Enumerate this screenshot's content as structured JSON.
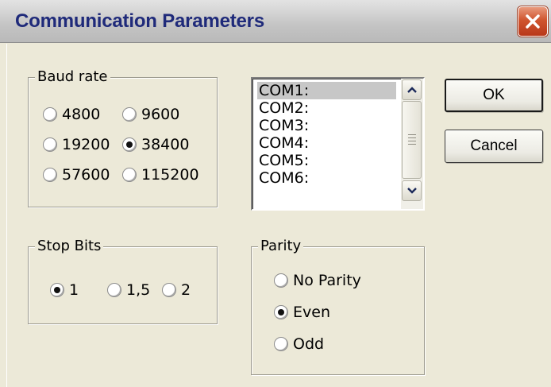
{
  "window": {
    "title": "Communication Parameters",
    "close_icon": "close-icon"
  },
  "baud_rate": {
    "legend": "Baud rate",
    "options": [
      "4800",
      "9600",
      "19200",
      "38400",
      "57600",
      "115200"
    ],
    "selected": "38400"
  },
  "ports": {
    "items": [
      "COM1:",
      "COM2:",
      "COM3:",
      "COM4:",
      "COM5:",
      "COM6:"
    ],
    "selected": "COM1:"
  },
  "buttons": {
    "ok": "OK",
    "cancel": "Cancel"
  },
  "stop_bits": {
    "legend": "Stop Bits",
    "options": [
      "1",
      "1,5",
      "2"
    ],
    "selected": "1"
  },
  "parity": {
    "legend": "Parity",
    "options": [
      "No Parity",
      "Even",
      "Odd"
    ],
    "selected": "Even"
  }
}
